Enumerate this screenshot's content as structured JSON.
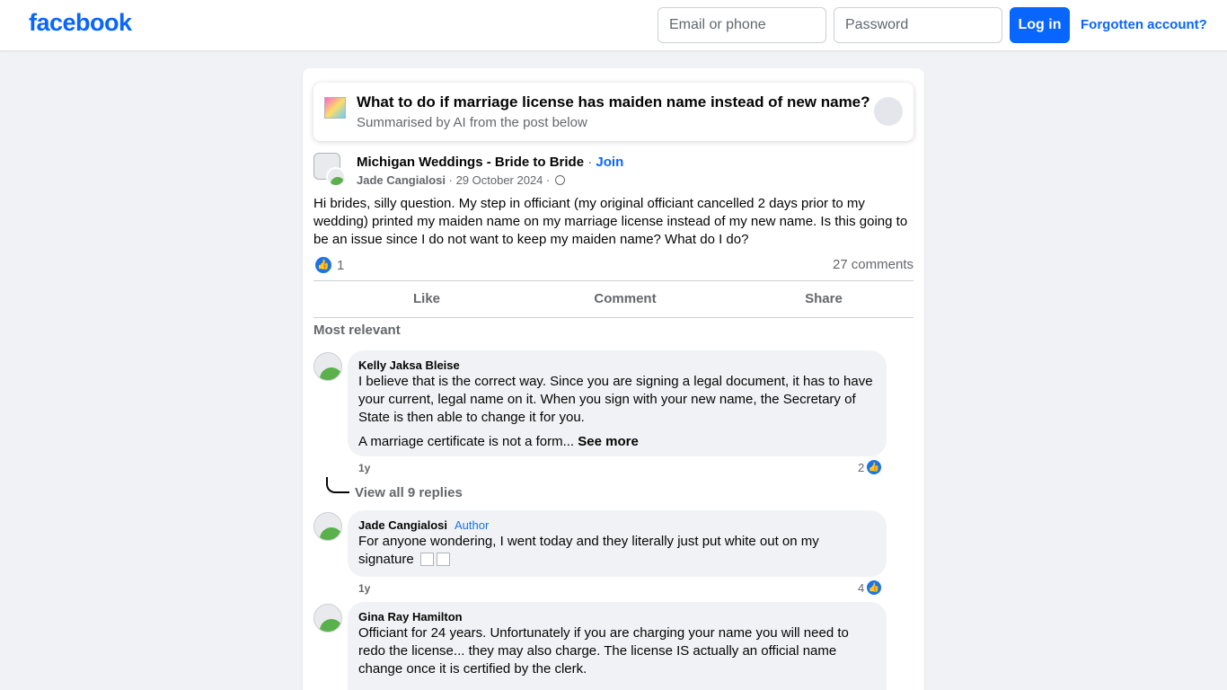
{
  "header": {
    "logo": "facebook",
    "email_placeholder": "Email or phone",
    "password_placeholder": "Password",
    "login_label": "Log in",
    "forgot_label": "Forgotten account?"
  },
  "summary": {
    "title": "What to do if marriage license has maiden name instead of new name?",
    "subtitle": "Summarised by AI from the post below"
  },
  "post": {
    "group": "Michigan Weddings - Bride to Bride",
    "separator": " · ",
    "join": "Join",
    "author": "Jade Cangialosi",
    "date": "29 October 2024",
    "text": "Hi brides, silly question. My step in officiant (my original officiant cancelled 2 days prior to my wedding) printed my maiden name on  my marriage license instead of my new name. Is this going to be an issue since I do not want to keep my maiden name? What do I do?",
    "reactions": "1",
    "comments_count": "27 comments",
    "actions": {
      "like": "Like",
      "comment": "Comment",
      "share": "Share"
    }
  },
  "comments_section": {
    "sort_label": "Most relevant",
    "comments": [
      {
        "name": "Kelly Jaksa Bleise",
        "text": "I believe that is the correct way. Since you are signing a legal document, it has to have your current, legal name on it. When you sign with your new name, the Secretary of State is then able to change it for you.",
        "more_text": "A marriage certificate is not a form... ",
        "see_more": "See more",
        "time": "1y",
        "likes": "2"
      },
      {
        "name": "Jade Cangialosi",
        "badge": "Author",
        "text": "For anyone wondering, I went today and they literally just put white out on my signature",
        "time": "1y",
        "likes": "4"
      },
      {
        "name": "Gina Ray Hamilton",
        "text": "Officiant for 24 years. Unfortunately if you are charging your name you will need to redo the license... they may also charge. The license IS actually an official name change once it is certified by the clerk."
      }
    ],
    "view_replies": "View all 9 replies"
  }
}
